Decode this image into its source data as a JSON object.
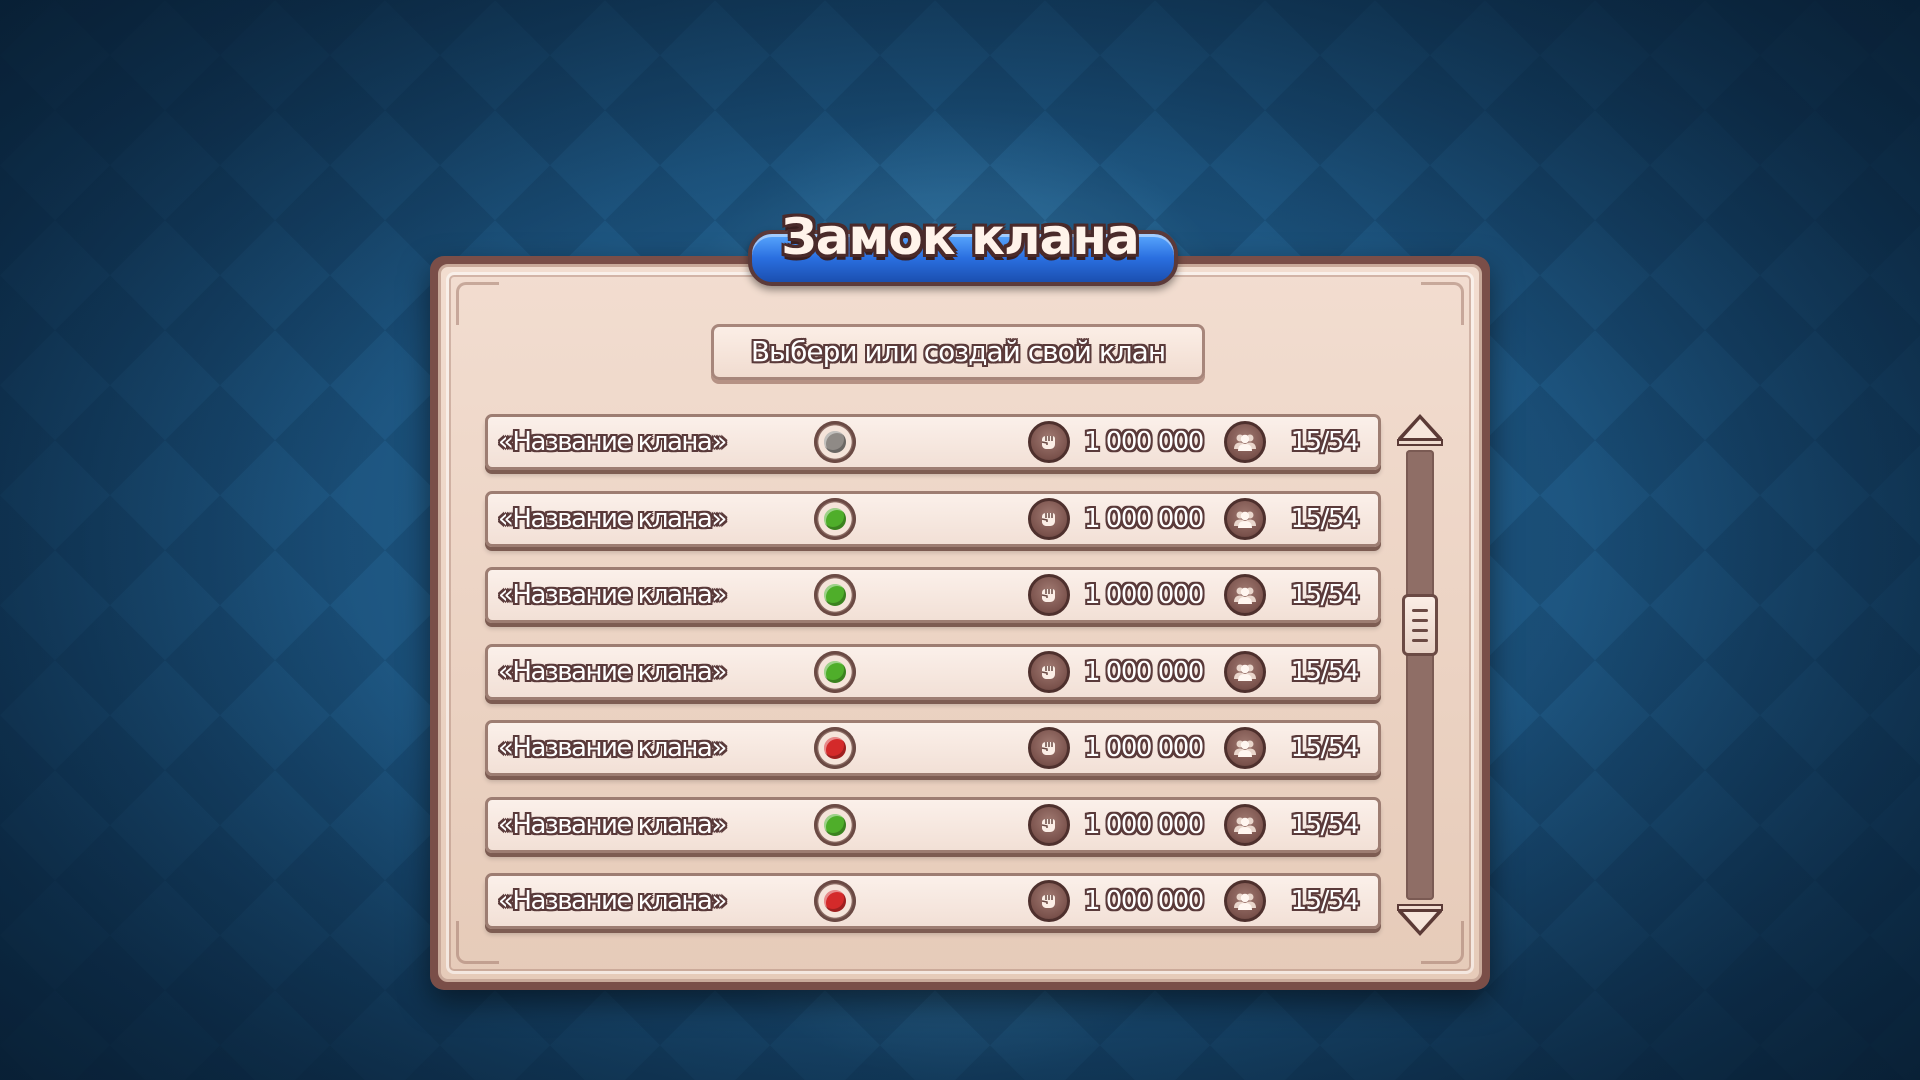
{
  "title": "Замок клана",
  "subtitle": "Выбери или создай свой клан",
  "status_colors": {
    "gray": "#8f8a86",
    "green": "#4fae2a",
    "red": "#d42a2a"
  },
  "icons": {
    "status": "status-gem-icon",
    "power": "fist-icon",
    "members": "members-icon",
    "scroll_up": "arrow-up-icon",
    "scroll_down": "arrow-down-icon"
  },
  "clans": [
    {
      "name": "«Название клана»",
      "status": "gray",
      "power": "1 000 000",
      "members": "15/54"
    },
    {
      "name": "«Название клана»",
      "status": "green",
      "power": "1 000 000",
      "members": "15/54"
    },
    {
      "name": "«Название клана»",
      "status": "green",
      "power": "1 000 000",
      "members": "15/54"
    },
    {
      "name": "«Название клана»",
      "status": "green",
      "power": "1 000 000",
      "members": "15/54"
    },
    {
      "name": "«Название клана»",
      "status": "red",
      "power": "1 000 000",
      "members": "15/54"
    },
    {
      "name": "«Название клана»",
      "status": "green",
      "power": "1 000 000",
      "members": "15/54"
    },
    {
      "name": "«Название клана»",
      "status": "red",
      "power": "1 000 000",
      "members": "15/54"
    }
  ],
  "scroll_position": 0.37
}
